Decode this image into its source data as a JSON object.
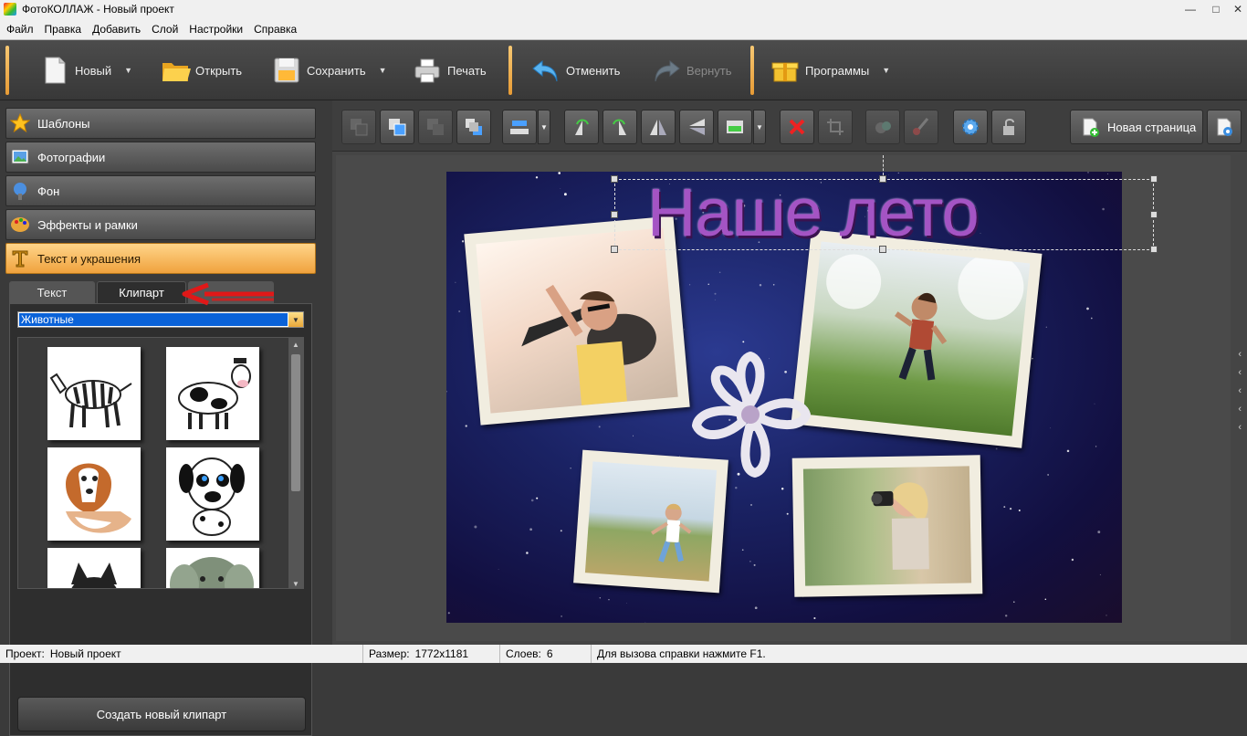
{
  "window": {
    "title": "ФотоКОЛЛАЖ - Новый проект",
    "controls": [
      "minimize-icon",
      "maximize-icon",
      "close-icon"
    ]
  },
  "menu": [
    "Файл",
    "Правка",
    "Добавить",
    "Слой",
    "Настройки",
    "Справка"
  ],
  "toolbar": {
    "new_label": "Новый",
    "open_label": "Открыть",
    "save_label": "Сохранить",
    "print_label": "Печать",
    "undo_label": "Отменить",
    "redo_label": "Вернуть",
    "programs_label": "Программы"
  },
  "categories": [
    {
      "label": "Шаблоны",
      "icon": "star-icon",
      "active": false
    },
    {
      "label": "Фотографии",
      "icon": "photo-icon",
      "active": false
    },
    {
      "label": "Фон",
      "icon": "background-icon",
      "active": false
    },
    {
      "label": "Эффекты и рамки",
      "icon": "palette-icon",
      "active": false
    },
    {
      "label": "Текст и украшения",
      "icon": "text-icon",
      "active": true
    }
  ],
  "tabs": {
    "text": "Текст",
    "clipart": "Клипарт",
    "active": "Клипарт"
  },
  "clipart": {
    "category": "Животные",
    "items": [
      "zebra",
      "cow",
      "collie-dog",
      "dalmatian-puppy",
      "husky-puppy",
      "elephant"
    ],
    "create_button": "Создать новый клипарт"
  },
  "page": {
    "new_page_label": "Новая страница"
  },
  "collage": {
    "caption": "Наше лето",
    "background_colors": [
      "#2b3a90",
      "#120f40"
    ],
    "stamp_color": "#f1ede0",
    "caption_color": "#a454c4"
  },
  "status": {
    "project_key": "Проект:",
    "project_value": "Новый проект",
    "size_key": "Размер:",
    "size_value": "1772x1181",
    "layers_key": "Слоев:",
    "layers_value": "6",
    "help": "Для вызова справки нажмите F1."
  },
  "colors": {
    "accent_orange": "#f0a23d",
    "selection_blue": "#0a62d8",
    "annotation_red": "#e01818"
  }
}
